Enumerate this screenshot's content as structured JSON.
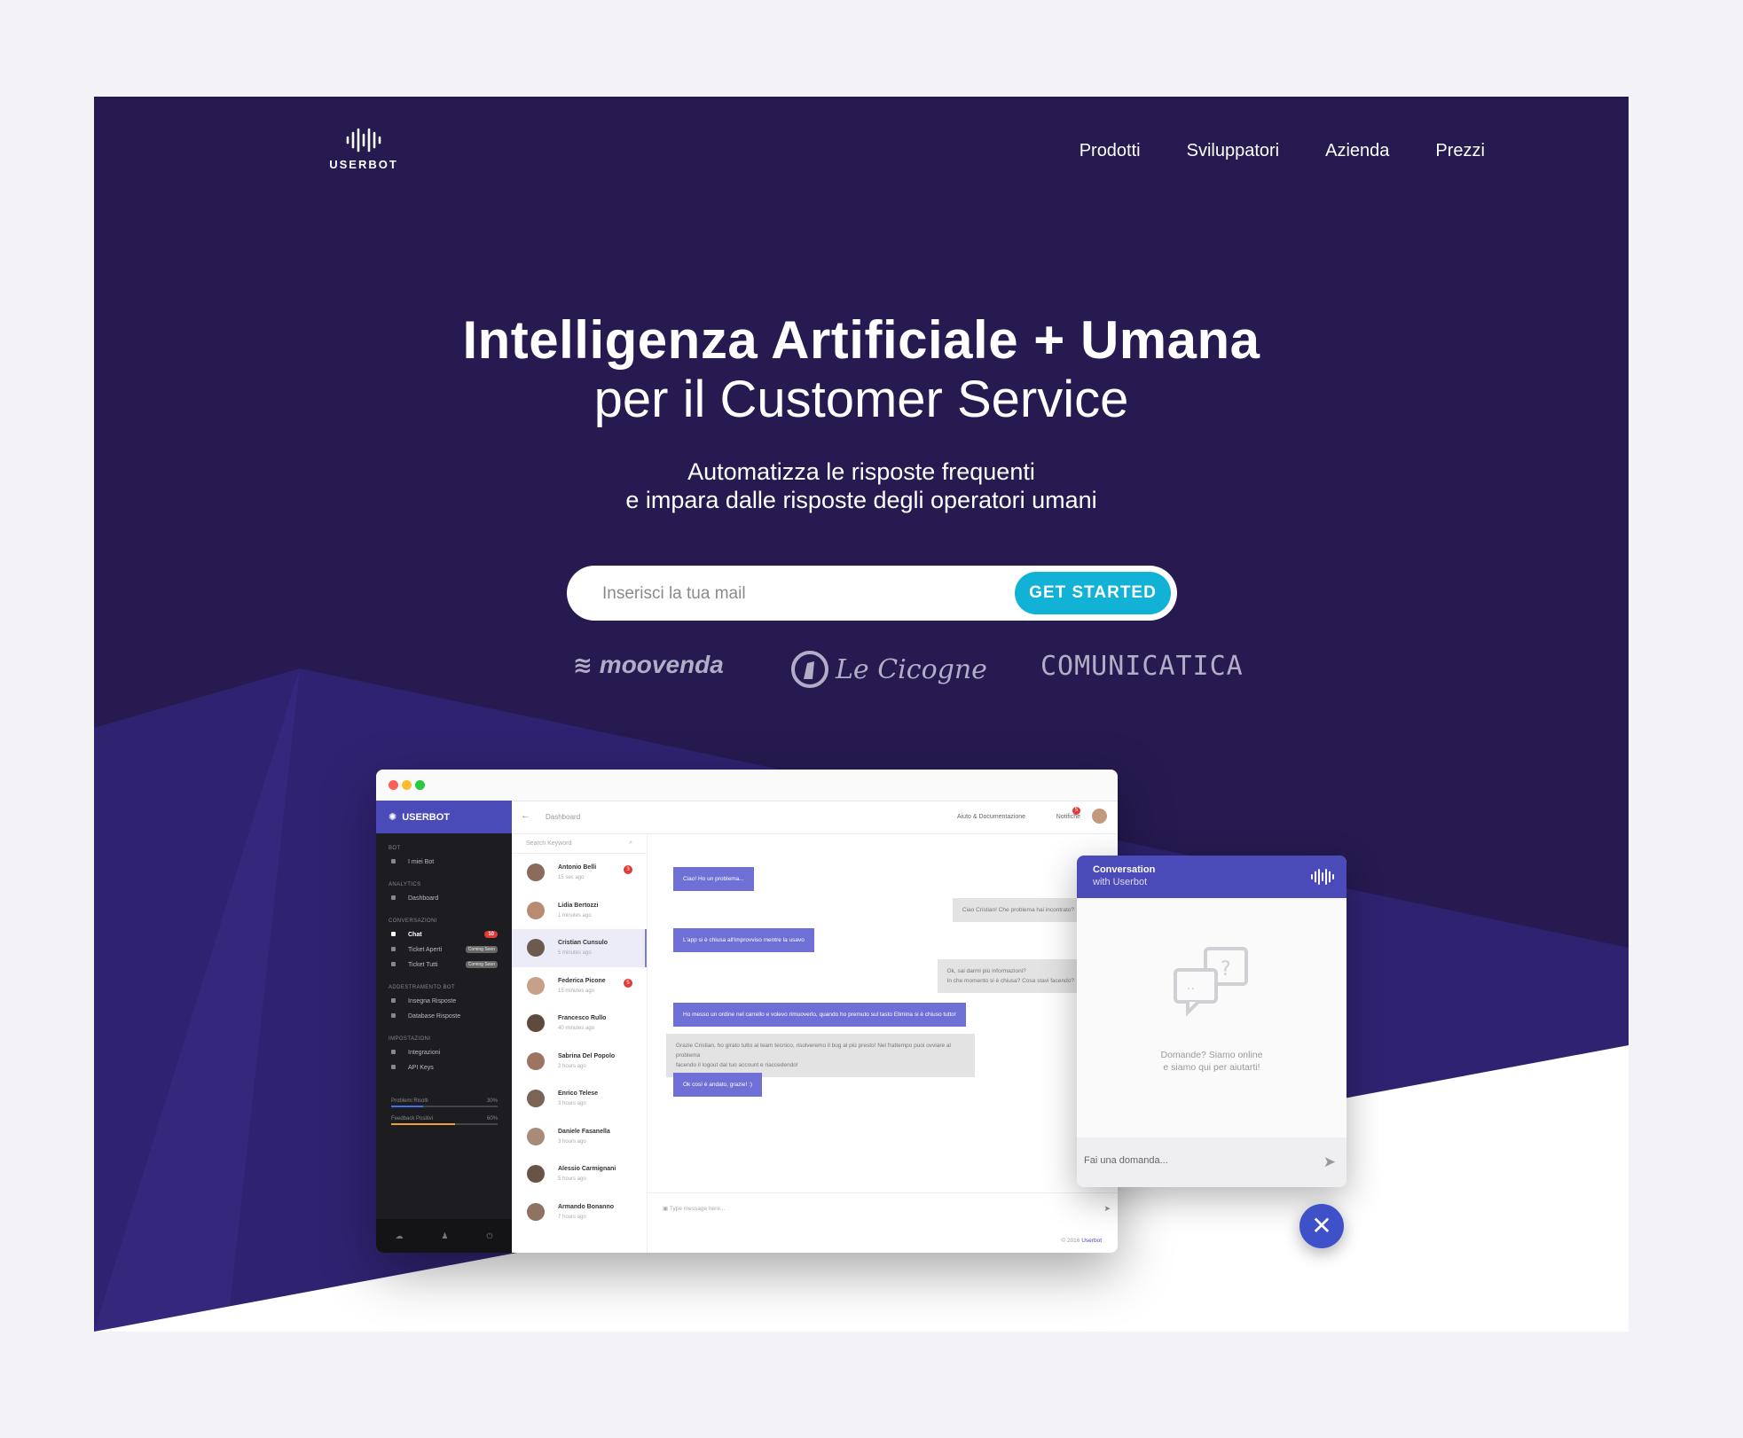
{
  "brand": {
    "name": "USERBOT"
  },
  "nav": {
    "items": [
      "Prodotti",
      "Sviluppatori",
      "Azienda",
      "Prezzi"
    ]
  },
  "hero": {
    "title_line1": "Intelligenza Artificiale + Umana",
    "title_line2": "per il Customer Service",
    "subtitle_line1": "Automatizza le risposte frequenti",
    "subtitle_line2": "e impara dalle risposte degli operatori umani",
    "email_placeholder": "Inserisci la tua mail",
    "cta_label": "GET STARTED"
  },
  "clients": [
    "moovenda",
    "Le Cicogne",
    "COMUNICATICA"
  ],
  "colors": {
    "hero_bg": "#261a50",
    "accent": "#12b1d6",
    "brand_blue": "#4a4ab8",
    "bubble_blue": "#6f70d6"
  },
  "app": {
    "brand": "USERBOT",
    "breadcrumb": "Dashboard",
    "help_label": "Aiuto & Documentazione",
    "notif_label": "Notifiche",
    "notif_count": "5",
    "sidebar": {
      "sections": [
        {
          "title": "BOT",
          "items": [
            {
              "label": "I miei Bot"
            }
          ]
        },
        {
          "title": "ANALYTICS",
          "items": [
            {
              "label": "Dashboard"
            }
          ]
        },
        {
          "title": "CONVERSAZIONI",
          "items": [
            {
              "label": "Chat",
              "badge": "10",
              "active": true
            },
            {
              "label": "Ticket Aperti",
              "tag": "Coming Soon"
            },
            {
              "label": "Ticket Tutti",
              "tag": "Coming Soon"
            }
          ]
        },
        {
          "title": "ADDESTRAMENTO BOT",
          "items": [
            {
              "label": "Insegna Risposte"
            },
            {
              "label": "Database Risposte"
            }
          ]
        },
        {
          "title": "IMPOSTAZIONI",
          "items": [
            {
              "label": "Integrazioni"
            },
            {
              "label": "API Keys"
            }
          ]
        }
      ],
      "stats": [
        {
          "label": "Problemi Risolti",
          "value": "30%",
          "fraction": 0.3,
          "color": "#4a6de8"
        },
        {
          "label": "Feedback Positivi",
          "value": "60%",
          "fraction": 0.6,
          "color": "#f0a030"
        }
      ]
    },
    "search_placeholder": "Search Keyword",
    "contacts": [
      {
        "name": "Antonio Belli",
        "time": "15 sec ago",
        "badge": "3"
      },
      {
        "name": "Lidia Bertozzi",
        "time": "1 minutes ago"
      },
      {
        "name": "Cristian Cunsulo",
        "time": "5 minutes ago",
        "selected": true
      },
      {
        "name": "Federica Picone",
        "time": "15 minutes ago",
        "badge": "5"
      },
      {
        "name": "Francesco Rullo",
        "time": "40 minutes ago"
      },
      {
        "name": "Sabrina Del Popolo",
        "time": "2 hours ago"
      },
      {
        "name": "Enrico Telese",
        "time": "3 hours ago"
      },
      {
        "name": "Daniele Fasanella",
        "time": "3 hours ago"
      },
      {
        "name": "Alessio Carmignani",
        "time": "5 hours ago"
      },
      {
        "name": "Armando Bonanno",
        "time": "7 hours ago"
      }
    ],
    "messages": [
      {
        "from": "user",
        "text": "Ciao! Ho un problema..."
      },
      {
        "from": "agent",
        "text": "Ciao Cristian! Che problema hai incontrato?"
      },
      {
        "from": "user",
        "text": "L'app si è chiusa all'improvviso mentre la usavo"
      },
      {
        "from": "agent",
        "text": "Ok, sai darmi più informazioni?\nIn che momento si è chiusa? Cosa stavi facendo?"
      },
      {
        "from": "user",
        "text": "Ho messo un ordine nel carrello e volevo rimuoverlo, quando ho premuto sul tasto Elimina si è chiuso tutto!"
      },
      {
        "from": "agent",
        "text": "Grazie Cristian, ho girato tutto al team tecnico, risolveremo il bug al più presto! Nel frattempo puoi ovviare al problema\nfacendo il logout dal tuo account e riaccedendo!"
      },
      {
        "from": "user",
        "text": "Ok così è andato, grazie! :)"
      }
    ],
    "chat_placeholder": "Type message here...",
    "copyright_prefix": "© 2016",
    "copyright_brand": "Userbot"
  },
  "widget": {
    "title": "Conversation",
    "subtitle": "with Userbot",
    "message_line1": "Domande? Siamo online",
    "message_line2": "e siamo qui per aiutarti!",
    "input_placeholder": "Fai una domanda..."
  }
}
